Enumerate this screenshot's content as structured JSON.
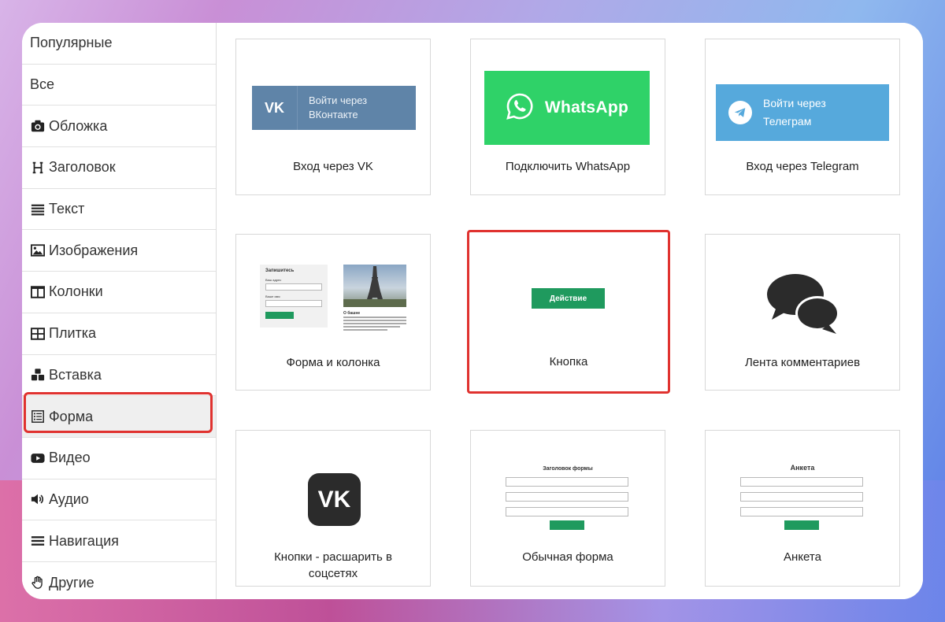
{
  "sidebar": {
    "items": [
      {
        "label": "Популярные",
        "icon": "none"
      },
      {
        "label": "Все",
        "icon": "none"
      },
      {
        "label": "Обложка",
        "icon": "camera-icon"
      },
      {
        "label": "Заголовок",
        "icon": "heading-icon"
      },
      {
        "label": "Текст",
        "icon": "text-lines-icon"
      },
      {
        "label": "Изображения",
        "icon": "image-icon"
      },
      {
        "label": "Колонки",
        "icon": "columns-icon"
      },
      {
        "label": "Плитка",
        "icon": "grid-icon"
      },
      {
        "label": "Вставка",
        "icon": "cubes-icon"
      },
      {
        "label": "Форма",
        "icon": "form-icon",
        "active": true
      },
      {
        "label": "Видео",
        "icon": "youtube-icon"
      },
      {
        "label": "Аудио",
        "icon": "speaker-icon"
      },
      {
        "label": "Навигация",
        "icon": "menu-icon"
      },
      {
        "label": "Другие",
        "icon": "hand-icon"
      }
    ]
  },
  "cards": {
    "vk_login": {
      "caption": "Вход через VK",
      "btn_logo": "VK",
      "btn_line1": "Войти через",
      "btn_line2": "ВКонтакте"
    },
    "whatsapp": {
      "caption": "Подключить WhatsApp",
      "btn_text": "WhatsApp"
    },
    "telegram": {
      "caption": "Вход через Telegram",
      "btn_line1": "Войти через",
      "btn_line2": "Телеграм"
    },
    "form_column": {
      "caption": "Форма и колонка",
      "form_title": "Запишитесь",
      "label1": "Ваш адрес",
      "label2": "Ваше имя",
      "article_title": "О башне"
    },
    "button": {
      "caption": "Кнопка",
      "btn_text": "Действие"
    },
    "comments": {
      "caption": "Лента комментариев"
    },
    "share": {
      "caption_line1": "Кнопки - расшарить в",
      "caption_line2": "соцсетях",
      "logo": "VK"
    },
    "simple_form": {
      "caption": "Обычная форма",
      "title": "Заголовок формы"
    },
    "survey": {
      "caption": "Анкета",
      "title": "Анкета"
    }
  },
  "colors": {
    "selection": "#e0322f",
    "vk": "#5f84a8",
    "whatsapp": "#2fd268",
    "telegram": "#56a9dc",
    "action": "#1f9a5e"
  }
}
